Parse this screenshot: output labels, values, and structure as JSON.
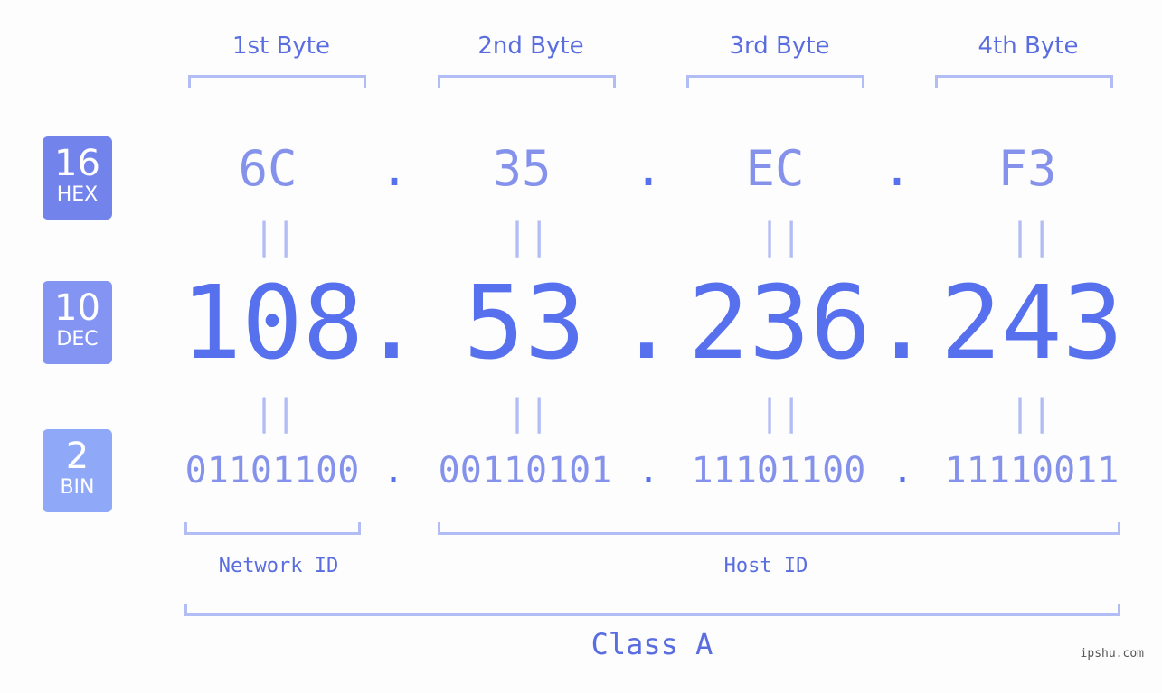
{
  "colors": {
    "hex_badge": "#7383EC",
    "dec_badge": "#8394F2",
    "bin_badge": "#8FA8F8",
    "primary": "#5770EE",
    "light_value": "#8592EC",
    "bracket": "#B3BDF5"
  },
  "badges": {
    "hex": {
      "num": "16",
      "label": "HEX"
    },
    "dec": {
      "num": "10",
      "label": "DEC"
    },
    "bin": {
      "num": "2",
      "label": "BIN"
    }
  },
  "byte_headers": [
    "1st Byte",
    "2nd Byte",
    "3rd Byte",
    "4th Byte"
  ],
  "separator": ".",
  "equals": "||",
  "hex_values": [
    "6C",
    "35",
    "EC",
    "F3"
  ],
  "dec_values": [
    "108",
    "53",
    "236",
    "243"
  ],
  "bin_values": [
    "01101100",
    "00110101",
    "11101100",
    "11110011"
  ],
  "network_id_label": "Network ID",
  "host_id_label": "Host ID",
  "class_label": "Class A",
  "watermark": "ipshu.com"
}
